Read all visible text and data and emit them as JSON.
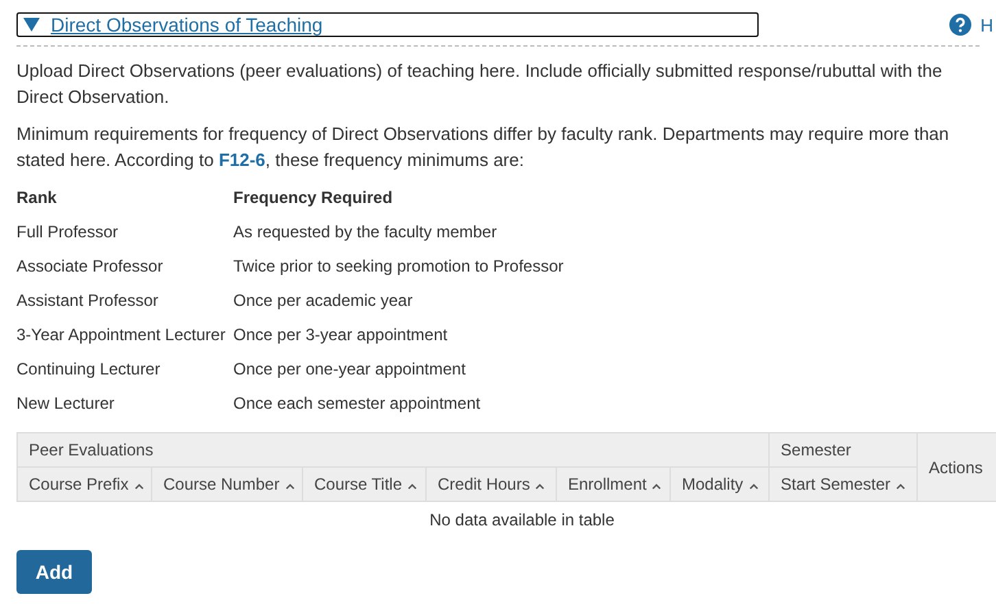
{
  "section": {
    "title": "Direct Observations of Teaching",
    "expanded": true,
    "help_label": "H"
  },
  "intro": "Upload Direct Observations (peer evaluations) of teaching here. Include officially submitted response/rubuttal with the Direct Observation.",
  "requirements": {
    "before": "Minimum requirements for frequency of Direct Observations differ by faculty rank. Departments may require more than stated here. According to ",
    "link": "F12-6",
    "after": ", these frequency minimums are:"
  },
  "rank_table": {
    "columns": [
      "Rank",
      "Frequency Required"
    ],
    "rows": [
      [
        "Full Professor",
        "As requested by the faculty member"
      ],
      [
        "Associate Professor",
        "Twice prior to seeking promotion to Professor"
      ],
      [
        "Assistant Professor",
        "Once per academic year"
      ],
      [
        "3-Year Appointment Lecturer",
        "Once per 3-year appointment"
      ],
      [
        "Continuing Lecturer",
        "Once per one-year appointment"
      ],
      [
        "New Lecturer",
        "Once each semester appointment"
      ]
    ]
  },
  "table": {
    "groups": [
      "Peer Evaluations",
      "Semester"
    ],
    "columns": [
      "Course Prefix",
      "Course Number",
      "Course Title",
      "Credit Hours",
      "Enrollment",
      "Modality",
      "Start Semester"
    ],
    "actions_label": "Actions",
    "empty_message": "No data available in table"
  },
  "add_button": "Add"
}
